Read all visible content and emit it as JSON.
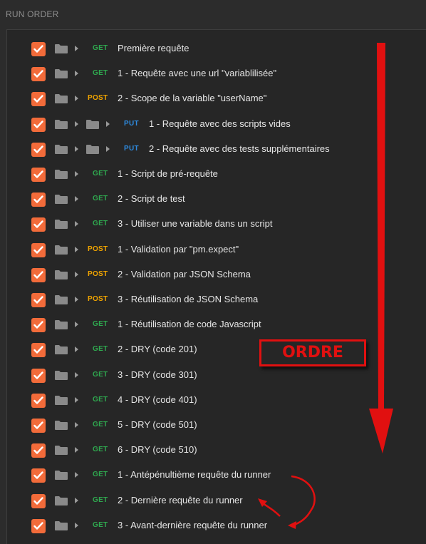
{
  "panel": {
    "title": "RUN ORDER"
  },
  "colors": {
    "accent": "#f26b3a",
    "get": "#2fa84f",
    "post": "#f0a400",
    "put": "#2e8be0",
    "annotation": "#e11010"
  },
  "requests": [
    {
      "method": "GET",
      "name": "Première requête",
      "depth": 0
    },
    {
      "method": "GET",
      "name": "1 - Requête avec une url \"variablilisée\"",
      "depth": 0
    },
    {
      "method": "POST",
      "name": "2 - Scope de la variable \"userName\"",
      "depth": 0
    },
    {
      "method": "PUT",
      "name": "1 - Requête avec des scripts vides",
      "depth": 1
    },
    {
      "method": "PUT",
      "name": "2 - Requête avec des tests supplémentaires",
      "depth": 1
    },
    {
      "method": "GET",
      "name": "1 - Script de pré-requête",
      "depth": 0
    },
    {
      "method": "GET",
      "name": "2 - Script de test",
      "depth": 0
    },
    {
      "method": "GET",
      "name": "3 - Utiliser une variable dans un script",
      "depth": 0
    },
    {
      "method": "POST",
      "name": "1 - Validation par \"pm.expect\"",
      "depth": 0
    },
    {
      "method": "POST",
      "name": "2 - Validation par JSON Schema",
      "depth": 0
    },
    {
      "method": "POST",
      "name": "3 - Réutilisation de JSON Schema",
      "depth": 0
    },
    {
      "method": "GET",
      "name": "1 - Réutilisation de code Javascript",
      "depth": 0
    },
    {
      "method": "GET",
      "name": "2 - DRY (code 201)",
      "depth": 0
    },
    {
      "method": "GET",
      "name": "3 - DRY (code 301)",
      "depth": 0
    },
    {
      "method": "GET",
      "name": "4 - DRY (code 401)",
      "depth": 0
    },
    {
      "method": "GET",
      "name": "5 - DRY (code 501)",
      "depth": 0
    },
    {
      "method": "GET",
      "name": "6 - DRY (code 510)",
      "depth": 0
    },
    {
      "method": "GET",
      "name": "1 - Antépénultième requête du runner",
      "depth": 0
    },
    {
      "method": "GET",
      "name": "2 - Dernière requête du runner",
      "depth": 0
    },
    {
      "method": "GET",
      "name": "3 - Avant-dernière requête du runner",
      "depth": 0
    }
  ],
  "annotation": {
    "label": "ORDRE"
  }
}
